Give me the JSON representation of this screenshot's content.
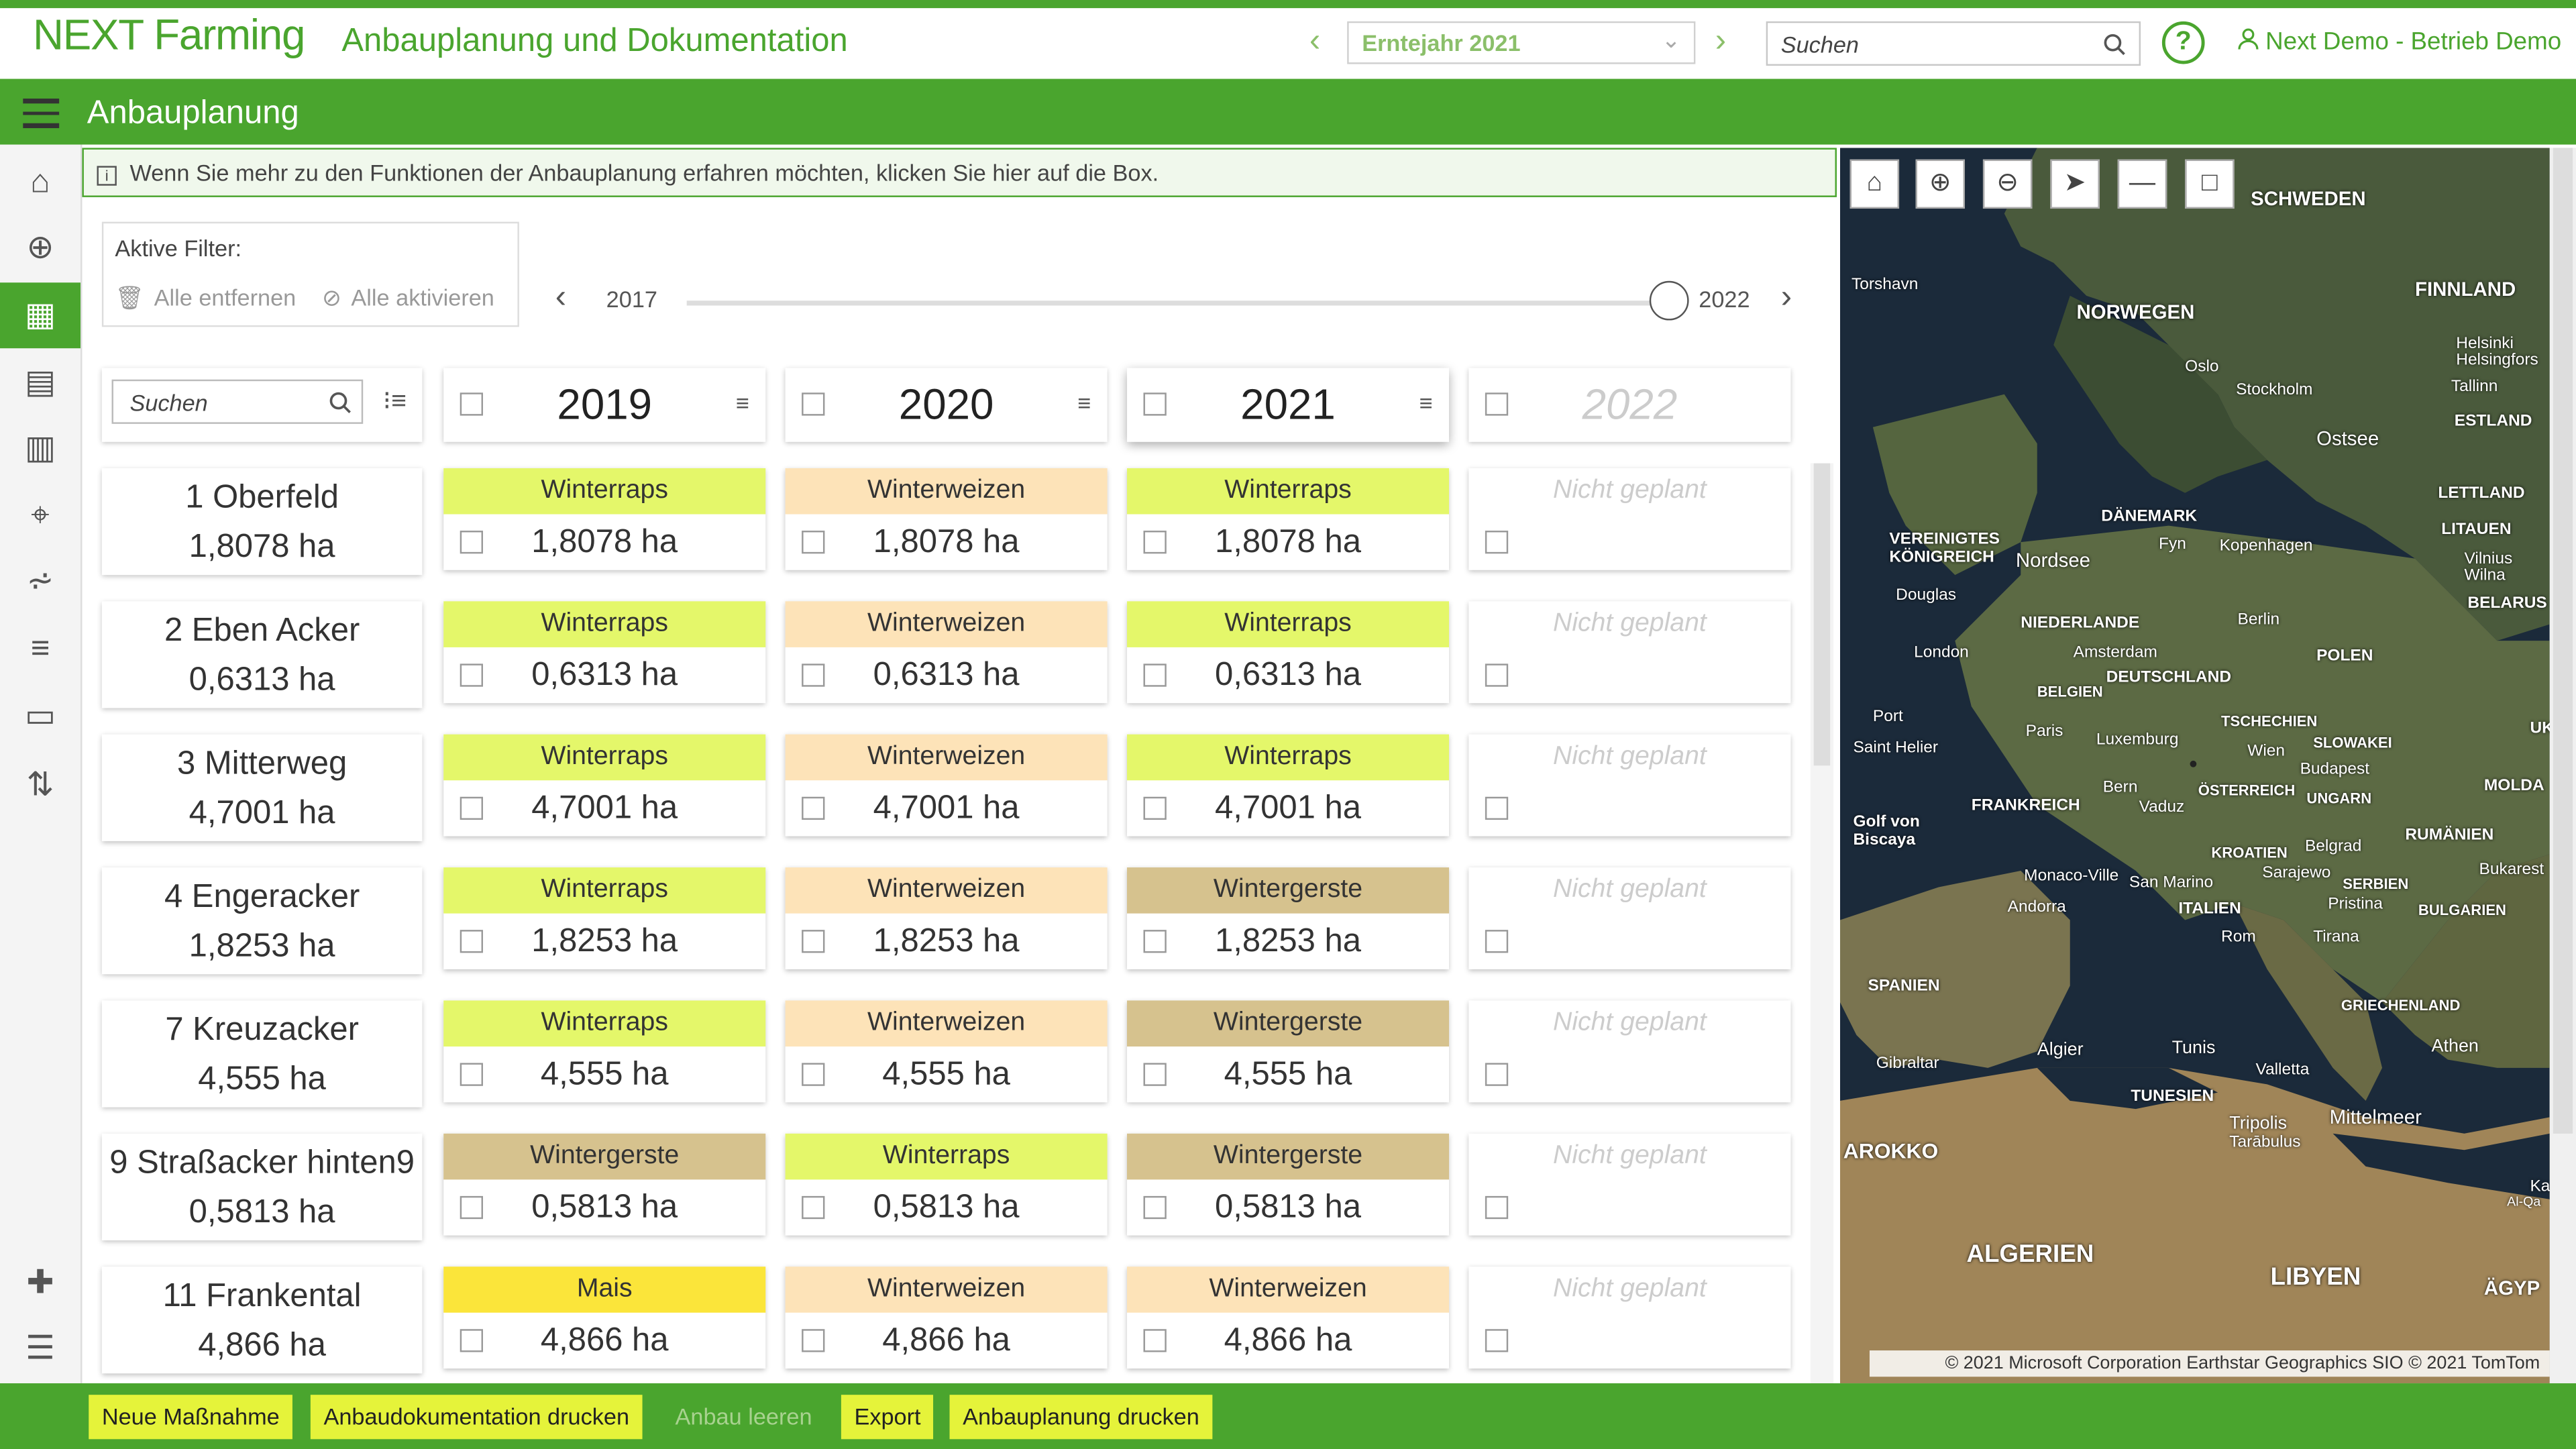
{
  "app": {
    "logo": "NEXT Farming",
    "title": "Anbauplanung und Dokumentation",
    "year_select": "Erntejahr 2021",
    "search_placeholder": "Suchen",
    "user": "Next Demo - Betrieb Demo"
  },
  "page": {
    "title": "Anbauplanung",
    "info": "Wenn Sie mehr zu den Funktionen der Anbauplanung erfahren möchten, klicken Sie hier auf die Box."
  },
  "filters": {
    "title": "Aktive Filter:",
    "remove_all": "Alle entfernen",
    "activate_all": "Alle aktivieren"
  },
  "timeline": {
    "start": "2017",
    "end": "2022"
  },
  "grid": {
    "search_placeholder": "Suchen",
    "years": [
      "2019",
      "2020",
      "2021",
      "2022"
    ],
    "not_planned": "Nicht geplant",
    "fields": [
      {
        "name": "1 Oberfeld",
        "area": "1,8078 ha",
        "crops": [
          {
            "crop": "Winterraps",
            "area": "1,8078 ha"
          },
          {
            "crop": "Winterweizen",
            "area": "1,8078 ha"
          },
          {
            "crop": "Winterraps",
            "area": "1,8078 ha"
          }
        ]
      },
      {
        "name": "2 Eben Acker",
        "area": "0,6313 ha",
        "crops": [
          {
            "crop": "Winterraps",
            "area": "0,6313 ha"
          },
          {
            "crop": "Winterweizen",
            "area": "0,6313 ha"
          },
          {
            "crop": "Winterraps",
            "area": "0,6313 ha"
          }
        ]
      },
      {
        "name": "3 Mitterweg",
        "area": "4,7001 ha",
        "crops": [
          {
            "crop": "Winterraps",
            "area": "4,7001 ha"
          },
          {
            "crop": "Winterweizen",
            "area": "4,7001 ha"
          },
          {
            "crop": "Winterraps",
            "area": "4,7001 ha"
          }
        ]
      },
      {
        "name": "4 Engeracker",
        "area": "1,8253 ha",
        "crops": [
          {
            "crop": "Winterraps",
            "area": "1,8253 ha"
          },
          {
            "crop": "Winterweizen",
            "area": "1,8253 ha"
          },
          {
            "crop": "Wintergerste",
            "area": "1,8253 ha"
          }
        ]
      },
      {
        "name": "7 Kreuzacker",
        "area": "4,555 ha",
        "crops": [
          {
            "crop": "Winterraps",
            "area": "4,555 ha"
          },
          {
            "crop": "Winterweizen",
            "area": "4,555 ha"
          },
          {
            "crop": "Wintergerste",
            "area": "4,555 ha"
          }
        ]
      },
      {
        "name": "9 Straßacker hinten9",
        "area": "0,5813 ha",
        "crops": [
          {
            "crop": "Wintergerste",
            "area": "0,5813 ha"
          },
          {
            "crop": "Winterraps",
            "area": "0,5813 ha"
          },
          {
            "crop": "Wintergerste",
            "area": "0,5813 ha"
          }
        ]
      },
      {
        "name": "11 Frankental",
        "area": "4,866 ha",
        "crops": [
          {
            "crop": "Mais",
            "area": "4,866 ha"
          },
          {
            "crop": "Winterweizen",
            "area": "4,866 ha"
          },
          {
            "crop": "Winterweizen",
            "area": "4,866 ha"
          }
        ]
      }
    ]
  },
  "crop_colors": {
    "Winterraps": "#e4f76a",
    "Winterweizen": "#fde3b8",
    "Wintergerste": "#d6c28e",
    "Mais": "#fbe53a"
  },
  "map": {
    "labels": [
      "SCHWEDEN",
      "FINNLAND",
      "NORWEGEN",
      "Torshavn",
      "Oslo",
      "Helsinki",
      "Helsingfors",
      "Stockholm",
      "Tallinn",
      "ESTLAND",
      "Ostsee",
      "LETTLAND",
      "DÄNEMARK",
      "LITAUEN",
      "VEREINIGTES KÖNIGREICH",
      "Nordsee",
      "Fyn",
      "Kopenhagen",
      "Vilnius",
      "Wilna",
      "Douglas",
      "BELARUS",
      "NIEDERLANDE",
      "Berlin",
      "London",
      "Amsterdam",
      "POLEN",
      "DEUTSCHLAND",
      "BELGIEN",
      "Port",
      "Saint Helier",
      "TSCHECHIEN",
      "SLOWAKEI",
      "Paris",
      "Luxemburg",
      "Wien",
      "Budapest",
      "ÖSTERREICH",
      "UNGARN",
      "FRANKREICH",
      "Bern",
      "Vaduz",
      "Golf von Biscaya",
      "KROATIEN",
      "RUMÄNIEN",
      "Belgrad",
      "Bukarest",
      "Monaco-Ville",
      "San Marino",
      "Sarajewo",
      "SERBIEN",
      "Andorra",
      "ITALIEN",
      "BULGARIEN",
      "Pristina",
      "Rom",
      "Tirana",
      "SPANIEN",
      "GRIECHENLAND",
      "Athen",
      "Algier",
      "Tunis",
      "Gibraltar",
      "Valletta",
      "TUNESIEN",
      "Mittelmeer",
      "Tripolis",
      "Tarābulus",
      "AROKKO",
      "ALGERIEN",
      "LIBYEN",
      "ÄGYP",
      "MOLDA",
      "UK",
      "Ka",
      "Al-Qa"
    ],
    "copyright": "© 2021 Microsoft Corporation Earthstar Geographics SIO © 2021 TomTom"
  },
  "toolbar": {
    "new_measure": "Neue Maßnahme",
    "print_doc": "Anbaudokumentation drucken",
    "clear": "Anbau leeren",
    "export": "Export",
    "print_plan": "Anbauplanung drucken"
  },
  "colors": {
    "brand": "#4aa52e",
    "button": "#e5f33a"
  }
}
